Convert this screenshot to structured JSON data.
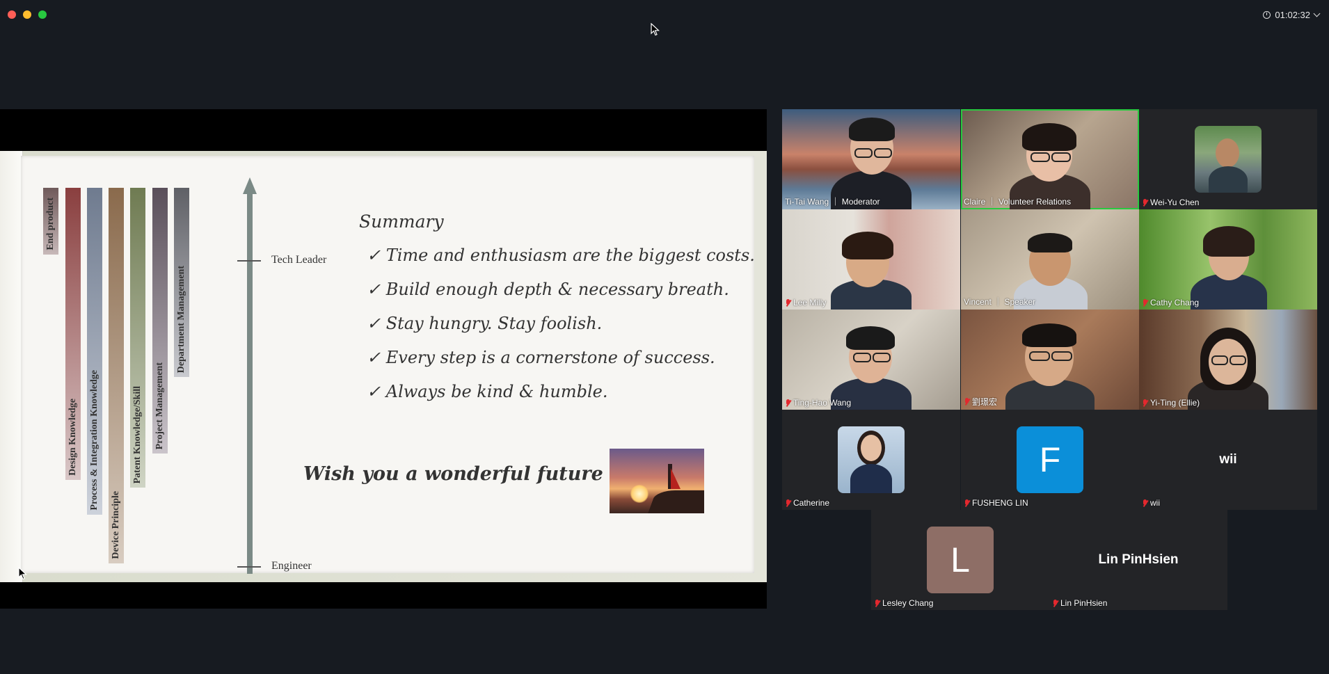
{
  "window": {
    "timer": "01:02:32",
    "colors": {
      "close": "#ff5f57",
      "minimize": "#febc2e",
      "maximize": "#28c840",
      "active_speaker": "#29c940",
      "mic_muted": "#e3282e"
    }
  },
  "slide": {
    "bars": [
      {
        "label": "End product",
        "color_top": "#6f5a5a",
        "color_bottom": "#c7b8b8"
      },
      {
        "label": "Design Knowledge",
        "color_top": "#8a3f3f",
        "color_bottom": "#d9c7c7"
      },
      {
        "label": "Process & Integration Knowledge",
        "color_top": "#6f7b8f",
        "color_bottom": "#cdd2db"
      },
      {
        "label": "Device Principle",
        "color_top": "#8a6a4c",
        "color_bottom": "#d8ccc0"
      },
      {
        "label": "Patent Knowledge/Skill",
        "color_top": "#6f7b52",
        "color_bottom": "#cfd4c4"
      },
      {
        "label": "Project Management",
        "color_top": "#5a4f5a",
        "color_bottom": "#cac4ca"
      },
      {
        "label": "Department Management",
        "color_top": "#5f6066",
        "color_bottom": "#c9cacf"
      }
    ],
    "axis": {
      "top_label": "Tech Leader",
      "bottom_label": "Engineer"
    },
    "summary_title": "Summary",
    "summary_items": [
      "✓ Time and enthusiasm are the biggest costs.",
      "✓ Build enough depth & necessary breath.",
      "✓ Stay hungry. Stay foolish.",
      "✓ Every step is a cornerstone of success.",
      "✓ Always be kind & humble."
    ],
    "wish": "Wish you a wonderful future"
  },
  "participants": [
    {
      "name": "Ti-Tai Wang ｜ Moderator",
      "muted": false
    },
    {
      "name": "Claire ｜ Volunteer Relations",
      "muted": false,
      "active": true
    },
    {
      "name": "Wei-Yu Chen",
      "muted": true
    },
    {
      "name": "Lee Milly",
      "muted": true
    },
    {
      "name": "Vincent ｜ Speaker",
      "muted": false
    },
    {
      "name": "Cathy Chang",
      "muted": true
    },
    {
      "name": "Ting-Hao Wang",
      "muted": true
    },
    {
      "name": "劉璟宏",
      "muted": true
    },
    {
      "name": "Yi-Ting (Ellie)",
      "muted": true
    },
    {
      "name": "Catherine",
      "muted": true
    },
    {
      "name": "FUSHENG LIN",
      "muted": true,
      "avatar_letter": "F",
      "avatar_color": "#0b8fd9"
    },
    {
      "name": "wii",
      "muted": true,
      "display_name": "wii"
    },
    {
      "name": "Lesley Chang",
      "muted": true,
      "avatar_letter": "L",
      "avatar_color": "#8e6e66"
    },
    {
      "name": "Lin PinHsien",
      "muted": true,
      "display_name": "Lin PinHsien"
    }
  ]
}
